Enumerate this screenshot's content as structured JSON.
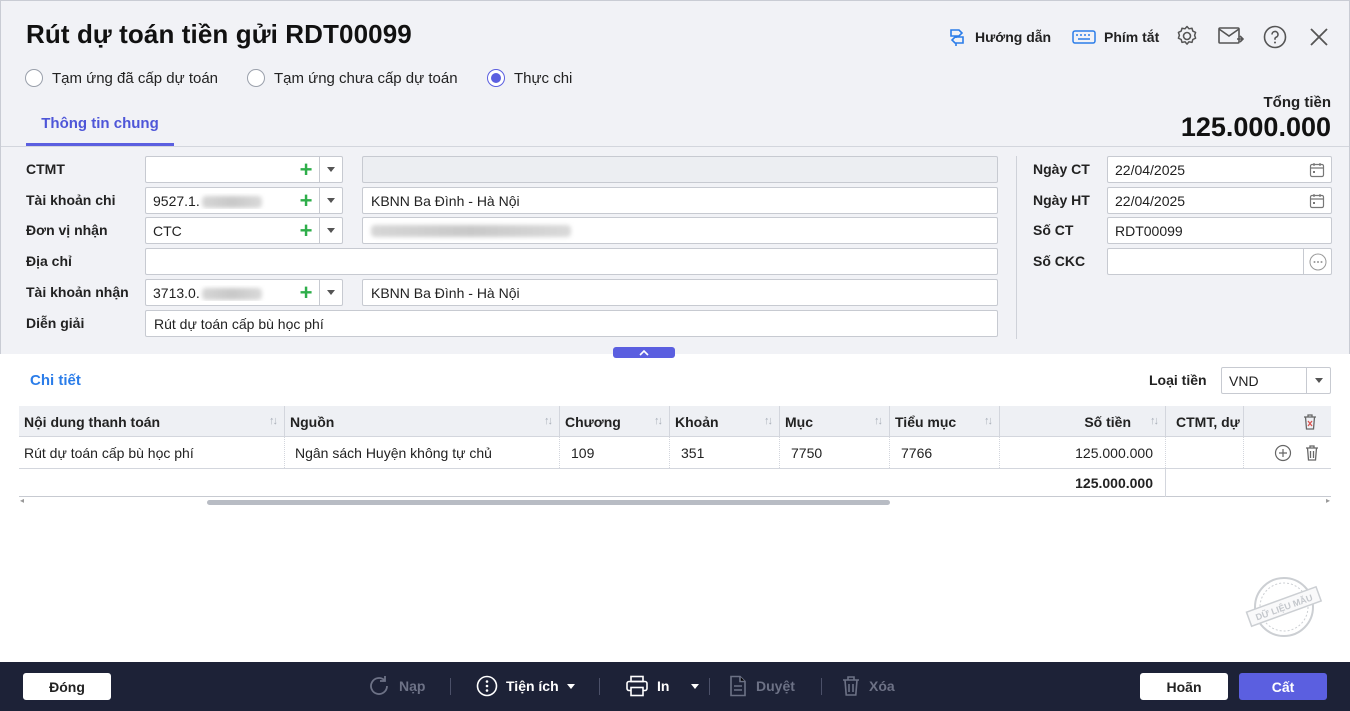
{
  "window": {
    "title": "Rút dự toán tiền gửi RDT00099"
  },
  "header": {
    "guide_label": "Hướng dẫn",
    "shortcut_label": "Phím tắt"
  },
  "radios": [
    {
      "label": "Tạm ứng đã cấp dự toán",
      "selected": false
    },
    {
      "label": "Tạm ứng chưa cấp dự toán",
      "selected": false
    },
    {
      "label": "Thực chi",
      "selected": true
    }
  ],
  "tabs": {
    "general": "Thông tin chung"
  },
  "total": {
    "label": "Tổng tiền",
    "value": "125.000.000"
  },
  "form": {
    "ctmt": {
      "label": "CTMT",
      "value": "",
      "desc": ""
    },
    "tk_chi": {
      "label": "Tài khoản chi",
      "value": "9527.1.",
      "desc": "KBNN Ba Đình - Hà Nội"
    },
    "don_vi": {
      "label": "Đơn vị nhận",
      "value": "CTC",
      "desc": ""
    },
    "dia_chi": {
      "label": "Địa chỉ",
      "value": ""
    },
    "tk_nhan": {
      "label": "Tài khoản nhận",
      "value": "3713.0.",
      "desc": "KBNN Ba Đình - Hà Nội"
    },
    "dien_giai": {
      "label": "Diễn giải",
      "value": "Rút dự toán cấp bù học phí"
    }
  },
  "right_form": {
    "ngay_ct": {
      "label": "Ngày CT",
      "value": "22/04/2025"
    },
    "ngay_ht": {
      "label": "Ngày HT",
      "value": "22/04/2025"
    },
    "so_ct": {
      "label": "Số CT",
      "value": "RDT00099"
    },
    "so_ckc": {
      "label": "Số CKC",
      "value": ""
    }
  },
  "detail": {
    "title": "Chi tiết",
    "currency_label": "Loại tiền",
    "currency_value": "VND",
    "columns": [
      "Nội dung thanh toán",
      "Nguồn",
      "Chương",
      "Khoản",
      "Mục",
      "Tiểu mục",
      "Số tiền",
      "CTMT, dự"
    ],
    "rows": [
      {
        "noi_dung": "Rút dự toán cấp bù học phí",
        "nguon": "Ngân sách Huyện không tự chủ",
        "chuong": "109",
        "khoan": "351",
        "muc": "7750",
        "tieu_muc": "7766",
        "so_tien": "125.000.000",
        "ctmt": ""
      }
    ],
    "footer_total": "125.000.000"
  },
  "stamp": {
    "text": "DỮ LIỆU MẪU"
  },
  "toolbar": {
    "close": "Đóng",
    "reload": "Nạp",
    "utilities": "Tiện ích",
    "print": "In",
    "approve": "Duyệt",
    "delete": "Xóa",
    "cancel": "Hoãn",
    "save": "Cất"
  },
  "colors": {
    "accent": "#5b5fe0",
    "link": "#2b7de9",
    "add": "#2eae4a",
    "footer_bg": "#1d2237"
  }
}
